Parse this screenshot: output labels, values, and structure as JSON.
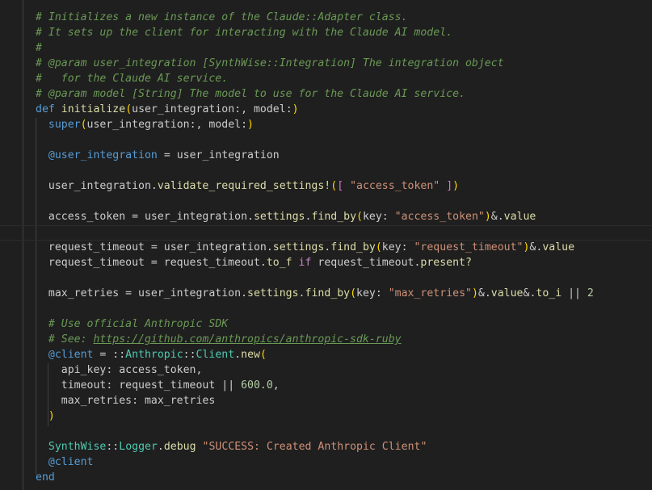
{
  "colors": {
    "background": "#1f1f1f",
    "comment": "#6a9955",
    "keyword": "#569cd6",
    "function": "#dcdcaa",
    "string": "#ce9178",
    "number": "#b5cea8",
    "constant": "#4ec9b0",
    "bracket_level_1": "#ffd700",
    "bracket_level_2": "#da70d6",
    "bracket_level_3": "#179fff"
  },
  "code_lines": [
    [
      [
        "comment",
        "# Initializes a new instance of the Claude::Adapter class."
      ]
    ],
    [
      [
        "comment",
        "# It sets up the client for interacting with the Claude AI model."
      ]
    ],
    [
      [
        "comment",
        "#"
      ]
    ],
    [
      [
        "comment",
        "# @param user_integration [SynthWise::Integration] The integration object"
      ]
    ],
    [
      [
        "comment",
        "#   for the Claude AI service."
      ]
    ],
    [
      [
        "comment",
        "# @param model [String] The model to use for the Claude AI service."
      ]
    ],
    [
      [
        "kw",
        "def"
      ],
      [
        "punct",
        " "
      ],
      [
        "fn",
        "initialize"
      ],
      [
        "p1",
        "("
      ],
      [
        "var",
        "user_integration:, model:"
      ],
      [
        "p1",
        ")"
      ]
    ],
    [
      [
        "punct",
        "  "
      ],
      [
        "kw",
        "super"
      ],
      [
        "p1",
        "("
      ],
      [
        "var",
        "user_integration:, model:"
      ],
      [
        "p1",
        ")"
      ]
    ],
    [],
    [
      [
        "punct",
        "  "
      ],
      [
        "ivar",
        "@user_integration"
      ],
      [
        "punct",
        " = user_integration"
      ]
    ],
    [],
    [
      [
        "punct",
        "  user_integration."
      ],
      [
        "fn",
        "validate_required_settings!"
      ],
      [
        "p1",
        "("
      ],
      [
        "p2",
        "["
      ],
      [
        "punct",
        " "
      ],
      [
        "str",
        "\"access_token\""
      ],
      [
        "punct",
        " "
      ],
      [
        "p2",
        "]"
      ],
      [
        "p1",
        ")"
      ]
    ],
    [],
    [
      [
        "punct",
        "  access_token = user_integration."
      ],
      [
        "fn",
        "settings"
      ],
      [
        "punct",
        "."
      ],
      [
        "fn",
        "find_by"
      ],
      [
        "p1",
        "("
      ],
      [
        "var",
        "key: "
      ],
      [
        "str",
        "\"access_token\""
      ],
      [
        "p1",
        ")"
      ],
      [
        "punct",
        "&."
      ],
      [
        "fn",
        "value"
      ]
    ],
    [],
    [
      [
        "punct",
        "  request_timeout = user_integration."
      ],
      [
        "fn",
        "settings"
      ],
      [
        "punct",
        "."
      ],
      [
        "fn",
        "find_by"
      ],
      [
        "p1",
        "("
      ],
      [
        "var",
        "key: "
      ],
      [
        "str",
        "\"request_timeout\""
      ],
      [
        "p1",
        ")"
      ],
      [
        "punct",
        "&."
      ],
      [
        "fn",
        "value"
      ]
    ],
    [
      [
        "punct",
        "  request_timeout = request_timeout."
      ],
      [
        "fn",
        "to_f"
      ],
      [
        "punct",
        " "
      ],
      [
        "ctrl",
        "if"
      ],
      [
        "punct",
        " request_timeout."
      ],
      [
        "fn",
        "present?"
      ]
    ],
    [],
    [
      [
        "punct",
        "  max_retries = user_integration."
      ],
      [
        "fn",
        "settings"
      ],
      [
        "punct",
        "."
      ],
      [
        "fn",
        "find_by"
      ],
      [
        "p1",
        "("
      ],
      [
        "var",
        "key: "
      ],
      [
        "str",
        "\"max_retries\""
      ],
      [
        "p1",
        ")"
      ],
      [
        "punct",
        "&."
      ],
      [
        "fn",
        "value"
      ],
      [
        "punct",
        "&."
      ],
      [
        "fn",
        "to_i"
      ],
      [
        "punct",
        " || "
      ],
      [
        "num",
        "2"
      ]
    ],
    [],
    [
      [
        "punct",
        "  "
      ],
      [
        "comment",
        "# Use official Anthropic SDK"
      ]
    ],
    [
      [
        "punct",
        "  "
      ],
      [
        "comment",
        "# See: "
      ],
      [
        "link",
        "https://github.com/anthropics/anthropic-sdk-ruby"
      ]
    ],
    [
      [
        "punct",
        "  "
      ],
      [
        "ivar",
        "@client"
      ],
      [
        "punct",
        " = ::"
      ],
      [
        "const",
        "Anthropic"
      ],
      [
        "punct",
        "::"
      ],
      [
        "const",
        "Client"
      ],
      [
        "punct",
        "."
      ],
      [
        "fn",
        "new"
      ],
      [
        "p1",
        "("
      ]
    ],
    [
      [
        "punct",
        "    "
      ],
      [
        "var",
        "api_key: access_token,"
      ]
    ],
    [
      [
        "punct",
        "    "
      ],
      [
        "var",
        "timeout: request_timeout || "
      ],
      [
        "num",
        "600.0"
      ],
      [
        "punct",
        ","
      ]
    ],
    [
      [
        "punct",
        "    "
      ],
      [
        "var",
        "max_retries: max_retries"
      ]
    ],
    [
      [
        "punct",
        "  "
      ],
      [
        "p1",
        ")"
      ]
    ],
    [],
    [
      [
        "punct",
        "  "
      ],
      [
        "const",
        "SynthWise"
      ],
      [
        "punct",
        "::"
      ],
      [
        "const",
        "Logger"
      ],
      [
        "punct",
        "."
      ],
      [
        "fn",
        "debug"
      ],
      [
        "punct",
        " "
      ],
      [
        "str",
        "\"SUCCESS: Created Anthropic Client\""
      ]
    ],
    [
      [
        "punct",
        "  "
      ],
      [
        "ivar",
        "@client"
      ]
    ],
    [
      [
        "kw",
        "end"
      ]
    ]
  ]
}
